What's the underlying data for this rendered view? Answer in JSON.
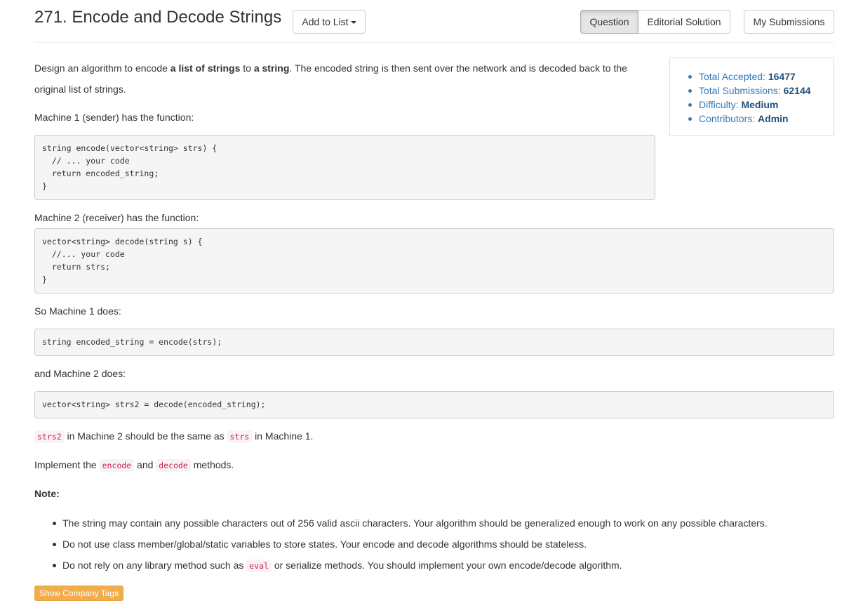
{
  "header": {
    "title": "271. Encode and Decode Strings",
    "add_to_list": "Add to List",
    "tabs": [
      "Question",
      "Editorial Solution"
    ],
    "my_submissions": "My Submissions"
  },
  "stats": {
    "accepted_label": "Total Accepted: ",
    "accepted_value": "16477",
    "submissions_label": "Total Submissions: ",
    "submissions_value": "62144",
    "difficulty_label": "Difficulty: ",
    "difficulty_value": "Medium",
    "contributors_label": "Contributors: ",
    "contributors_value": "Admin"
  },
  "content": {
    "intro_1": "Design an algorithm to encode ",
    "intro_b1": "a list of strings",
    "intro_2": " to ",
    "intro_b2": "a string",
    "intro_3": ". The encoded string is then sent over the network and is decoded back to the",
    "intro_4": "original list of strings.",
    "machine1_label": "Machine 1 (sender) has the function:",
    "code1": "string encode(vector<string> strs) {\n  // ... your code\n  return encoded_string;\n}",
    "machine2_label": "Machine 2 (receiver) has the function:",
    "code2": "vector<string> decode(string s) {\n  //... your code\n  return strs;\n}",
    "machine1_does": "So Machine 1 does:",
    "code3": "string encoded_string = encode(strs);",
    "machine2_does": "and Machine 2 does:",
    "code4": "vector<string> strs2 = decode(encoded_string);",
    "same_code1": "strs2",
    "same_text1": " in Machine 2 should be the same as ",
    "same_code2": "strs",
    "same_text2": " in Machine 1.",
    "impl_text1": "Implement the ",
    "impl_code1": "encode",
    "impl_text2": " and ",
    "impl_code2": "decode",
    "impl_text3": " methods.",
    "note_label": "Note:",
    "note_1": "The string may contain any possible characters out of 256 valid ascii characters. Your algorithm should be generalized enough to work on any possible characters.",
    "note_2": "Do not use class member/global/static variables to store states. Your encode and decode algorithms should be stateless.",
    "note_3_a": "Do not rely on any library method such as ",
    "note_3_code": "eval",
    "note_3_b": " or serialize methods. You should implement your own encode/decode algorithm.",
    "show_tags": "Show Company Tags"
  }
}
